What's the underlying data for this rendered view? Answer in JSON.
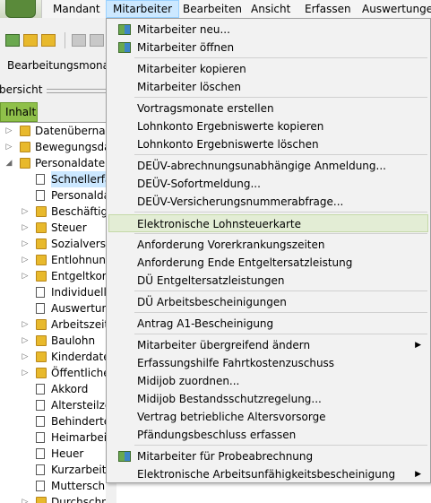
{
  "menubar": {
    "items": [
      "Mandant",
      "Mitarbeiter",
      "Bearbeiten",
      "Ansicht",
      "Erfassen",
      "Auswertungen"
    ],
    "active_index": 1
  },
  "left": {
    "bearbeitungsmonat_label": "Bearbeitungsmonat:",
    "section_label": "bersicht",
    "tab_label": "Inhalt",
    "tree": [
      {
        "label": "Datenübernahr",
        "kind": "folder",
        "level": 0,
        "expander": "collapsed"
      },
      {
        "label": "Bewegungsdat",
        "kind": "folder",
        "level": 0,
        "expander": "collapsed"
      },
      {
        "label": "Personaldaten",
        "kind": "folder",
        "level": 0,
        "expander": "expanded"
      },
      {
        "label": "Schnellerfa",
        "kind": "doc",
        "level": 1,
        "expander": "none",
        "selected": true
      },
      {
        "label": "Personaldat",
        "kind": "doc",
        "level": 1,
        "expander": "none"
      },
      {
        "label": "Beschäftigu",
        "kind": "folder",
        "level": 1,
        "expander": "collapsed"
      },
      {
        "label": "Steuer",
        "kind": "folder",
        "level": 1,
        "expander": "collapsed"
      },
      {
        "label": "Sozialversic",
        "kind": "folder",
        "level": 1,
        "expander": "collapsed"
      },
      {
        "label": "Entlohnung",
        "kind": "folder",
        "level": 1,
        "expander": "collapsed"
      },
      {
        "label": "Entgeltkom",
        "kind": "folder",
        "level": 1,
        "expander": "collapsed"
      },
      {
        "label": "Individuelle",
        "kind": "doc",
        "level": 1,
        "expander": "none"
      },
      {
        "label": "Auswertung",
        "kind": "doc",
        "level": 1,
        "expander": "none"
      },
      {
        "label": "Arbeitszeite",
        "kind": "folder",
        "level": 1,
        "expander": "collapsed"
      },
      {
        "label": "Baulohn",
        "kind": "folder",
        "level": 1,
        "expander": "collapsed"
      },
      {
        "label": "Kinderdaten",
        "kind": "folder",
        "level": 1,
        "expander": "collapsed"
      },
      {
        "label": "Öffentliche",
        "kind": "folder",
        "level": 1,
        "expander": "collapsed"
      },
      {
        "label": "Akkord",
        "kind": "doc",
        "level": 1,
        "expander": "none"
      },
      {
        "label": "Altersteilze",
        "kind": "doc",
        "level": 1,
        "expander": "none"
      },
      {
        "label": "Behinderte",
        "kind": "doc",
        "level": 1,
        "expander": "none"
      },
      {
        "label": "Heimarbeit",
        "kind": "doc",
        "level": 1,
        "expander": "none"
      },
      {
        "label": "Heuer",
        "kind": "doc",
        "level": 1,
        "expander": "none"
      },
      {
        "label": "Kurzarbeit",
        "kind": "doc",
        "level": 1,
        "expander": "none"
      },
      {
        "label": "Mutterschutz",
        "kind": "doc",
        "level": 1,
        "expander": "none"
      },
      {
        "label": "Durchschnittsspeicher",
        "kind": "folder",
        "level": 1,
        "expander": "collapsed"
      }
    ]
  },
  "dropdown": {
    "items": [
      {
        "label": "Mitarbeiter neu...",
        "icon": "new-employee-icon"
      },
      {
        "label": "Mitarbeiter öffnen",
        "icon": "open-employee-icon"
      },
      {
        "sep": true
      },
      {
        "label": "Mitarbeiter kopieren"
      },
      {
        "label": "Mitarbeiter löschen"
      },
      {
        "sep": true
      },
      {
        "label": "Vortragsmonate erstellen"
      },
      {
        "label": "Lohnkonto Ergebniswerte kopieren"
      },
      {
        "label": "Lohnkonto Ergebniswerte löschen"
      },
      {
        "sep": true
      },
      {
        "label": "DEÜV-abrechnungsunabhängige Anmeldung..."
      },
      {
        "label": "DEÜV-Sofortmeldung..."
      },
      {
        "label": "DEÜV-Versicherungsnummerabfrage..."
      },
      {
        "sep": true
      },
      {
        "label": "Elektronische Lohnsteuerkarte",
        "highlighted": true
      },
      {
        "sep": true
      },
      {
        "label": "Anforderung Vorerkrankungszeiten"
      },
      {
        "label": "Anforderung Ende Entgeltersatzleistung"
      },
      {
        "label": "DÜ Entgeltersatzleistungen"
      },
      {
        "sep": true
      },
      {
        "label": "DÜ Arbeitsbescheinigungen"
      },
      {
        "sep": true
      },
      {
        "label": "Antrag A1-Bescheinigung"
      },
      {
        "sep": true
      },
      {
        "label": "Mitarbeiter übergreifend ändern",
        "submenu": true
      },
      {
        "label": "Erfassungshilfe Fahrtkostenzuschuss"
      },
      {
        "label": "Midijob zuordnen..."
      },
      {
        "label": "Midijob Bestandsschutzregelung..."
      },
      {
        "label": "Vertrag betriebliche Altersvorsorge"
      },
      {
        "label": "Pfändungsbeschluss erfassen"
      },
      {
        "sep": true
      },
      {
        "label": "Mitarbeiter für Probeabrechnung",
        "icon": "trial-payroll-icon"
      },
      {
        "label": "Elektronische Arbeitsunfähigkeitsbescheinigung",
        "submenu": true
      }
    ]
  },
  "colors": {
    "menu_active": "#cce8ff",
    "highlight": "#e3edd5",
    "tab_green": "#8fc04a",
    "folder": "#e8b92c"
  }
}
